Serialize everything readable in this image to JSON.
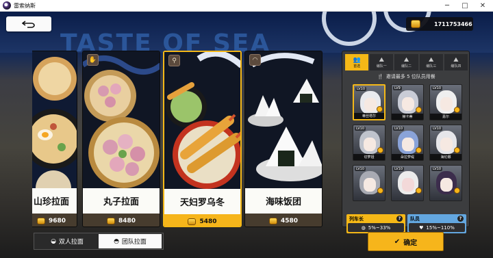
{
  "window": {
    "title": "雷索纳斯",
    "minimize_icon": "minimize-icon",
    "maximize_icon": "maximize-icon",
    "close_icon": "close-icon"
  },
  "header": {
    "back_icon": "return-arrow-icon",
    "watermark": "TASTE OF SEA",
    "currency_icon": "gold-coin-icon",
    "currency_value": "1711753466"
  },
  "dishes": [
    {
      "name": "山珍拉面",
      "price": "9680",
      "tag_icon": "bowl-icon",
      "selected": false
    },
    {
      "name": "丸子拉面",
      "price": "8480",
      "tag_icon": "hand-icon",
      "selected": false
    },
    {
      "name": "天妇罗乌冬",
      "price": "5480",
      "tag_icon": "knife-icon",
      "selected": true
    },
    {
      "name": "海味饭团",
      "price": "4580",
      "tag_icon": "dome-icon",
      "selected": false
    }
  ],
  "modes": [
    {
      "label": "双人拉面",
      "icon": "ramen-bowl-icon",
      "active": false
    },
    {
      "label": "团队拉面",
      "icon": "team-bowl-icon",
      "active": true
    }
  ],
  "team_tabs": [
    {
      "label": "首选",
      "active": true
    },
    {
      "label": "编队一",
      "active": false
    },
    {
      "label": "编队二",
      "active": false
    },
    {
      "label": "编队三",
      "active": false
    },
    {
      "label": "编队四",
      "active": false
    }
  ],
  "invite_hint": "邀请最多 5 位队员用餐",
  "characters": [
    {
      "level": "LV10",
      "name": "蒂丝塔尔",
      "selected": true
    },
    {
      "level": "LV9",
      "name": "赫卡蒂",
      "selected": false
    },
    {
      "level": "LV10",
      "name": "嘉尔",
      "selected": false
    },
    {
      "level": "LV10",
      "name": "切萝娅",
      "selected": false
    },
    {
      "level": "LV10",
      "name": "朵拉萝缇",
      "selected": false
    },
    {
      "level": "LV10",
      "name": "海伦娜",
      "selected": false
    },
    {
      "level": "LV10",
      "name": "",
      "selected": false
    },
    {
      "level": "LV10",
      "name": "",
      "selected": false
    },
    {
      "level": "LV10",
      "name": "",
      "selected": false
    }
  ],
  "bonus": {
    "captain": {
      "label": "列车长",
      "range": "5%~33%",
      "help": "?"
    },
    "member": {
      "label": "队员",
      "range": "15%~110%",
      "help": "?"
    }
  },
  "confirm_label": "确定",
  "colors": {
    "accent": "#f5b817",
    "member_blue": "#63a7e0",
    "panel": "#3c3d3f"
  }
}
